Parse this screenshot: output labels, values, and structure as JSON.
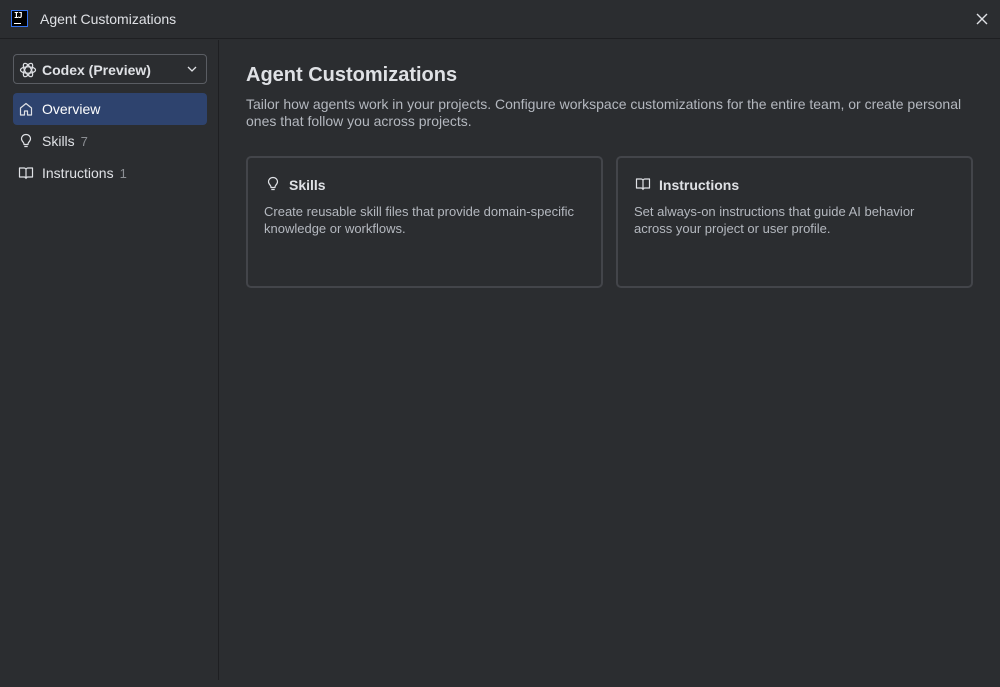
{
  "window": {
    "title": "Agent Customizations"
  },
  "sidebar": {
    "agent_select": {
      "value": "Codex (Preview)",
      "icon": "openai-icon"
    },
    "items": [
      {
        "label": "Overview",
        "count": "",
        "icon": "home-icon",
        "active": true
      },
      {
        "label": "Skills",
        "count": "7",
        "icon": "lightbulb-icon",
        "active": false
      },
      {
        "label": "Instructions",
        "count": "1",
        "icon": "book-icon",
        "active": false
      }
    ]
  },
  "main": {
    "title": "Agent Customizations",
    "description": "Tailor how agents work in your projects. Configure workspace customizations for the entire team, or create personal ones that follow you across projects.",
    "cards": [
      {
        "title": "Skills",
        "icon": "lightbulb-icon",
        "description": "Create reusable skill files that provide domain-specific knowledge or workflows."
      },
      {
        "title": "Instructions",
        "icon": "book-icon",
        "description": "Set always-on instructions that guide AI behavior across your project or user profile."
      }
    ]
  },
  "colors": {
    "background": "#2b2d30",
    "active_item": "#2e436e",
    "border": "#43454a",
    "text": "#dfe1e5",
    "muted_text": "#b4b8bf"
  }
}
